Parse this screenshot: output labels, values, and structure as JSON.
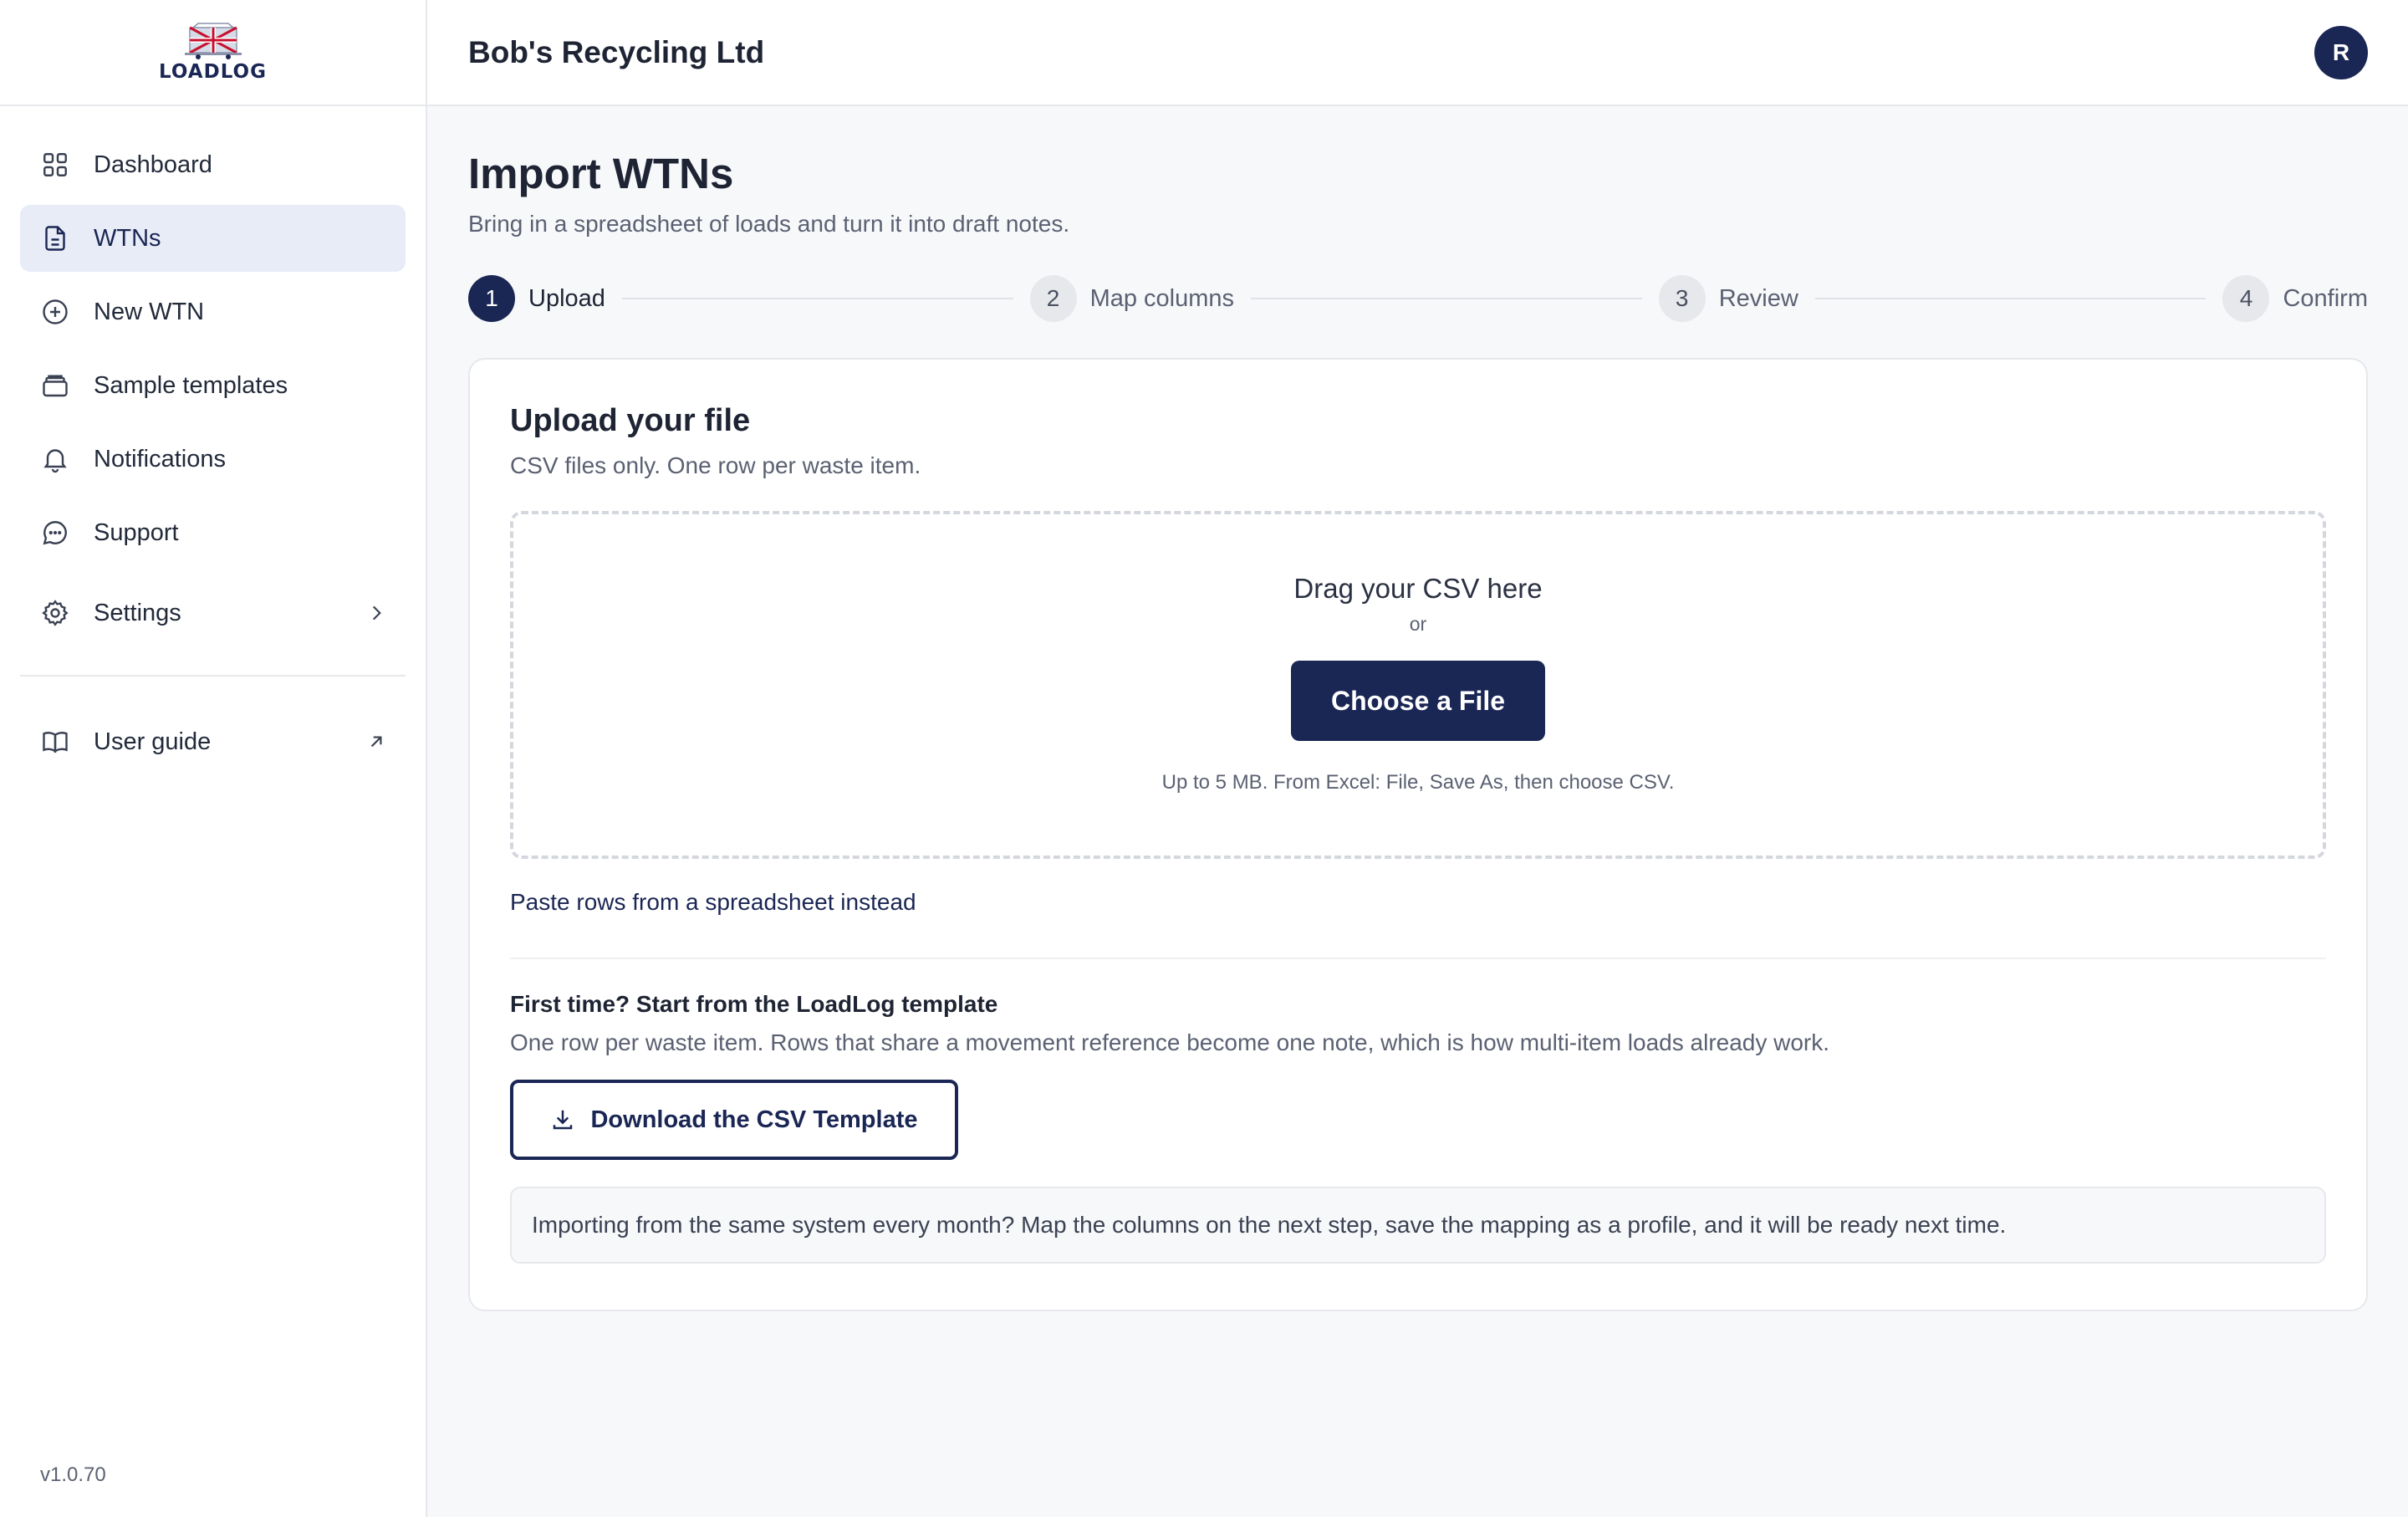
{
  "app": {
    "logo_text": "LOADLOG",
    "version": "v1.0.70"
  },
  "sidebar": {
    "items": [
      {
        "label": "Dashboard",
        "icon": "grid-icon"
      },
      {
        "label": "WTNs",
        "icon": "document-icon",
        "active": true
      },
      {
        "label": "New WTN",
        "icon": "plus-circle-icon"
      },
      {
        "label": "Sample templates",
        "icon": "archive-icon"
      },
      {
        "label": "Notifications",
        "icon": "bell-icon"
      },
      {
        "label": "Support",
        "icon": "chat-icon"
      },
      {
        "label": "Settings",
        "icon": "gear-icon",
        "trailing": "chevron-right-icon"
      }
    ],
    "footer_items": [
      {
        "label": "User guide",
        "icon": "book-icon",
        "trailing": "external-arrow-icon"
      }
    ]
  },
  "header": {
    "org_name": "Bob's Recycling Ltd",
    "avatar_initial": "R"
  },
  "page": {
    "title": "Import WTNs",
    "subtitle": "Bring in a spreadsheet of loads and turn it into draft notes."
  },
  "stepper": [
    {
      "num": "1",
      "label": "Upload",
      "active": true
    },
    {
      "num": "2",
      "label": "Map columns"
    },
    {
      "num": "3",
      "label": "Review"
    },
    {
      "num": "4",
      "label": "Confirm"
    }
  ],
  "upload": {
    "title": "Upload your file",
    "subtitle": "CSV files only. One row per waste item.",
    "dropzone_title": "Drag your CSV here",
    "dropzone_or": "or",
    "choose_button": "Choose a File",
    "hint": "Up to 5 MB. From Excel: File, Save As, then choose CSV.",
    "paste_link": "Paste rows from a spreadsheet instead",
    "template_title": "First time? Start from the LoadLog template",
    "template_desc": "One row per waste item. Rows that share a movement reference become one note, which is how multi-item loads already work.",
    "download_button": "Download the CSV Template",
    "tip": "Importing from the same system every month? Map the columns on the next step, save the mapping as a profile, and it will be ready next time."
  },
  "colors": {
    "brand": "#1a2654",
    "active_bg": "#e8ecf6",
    "muted_text": "#5b6172"
  }
}
